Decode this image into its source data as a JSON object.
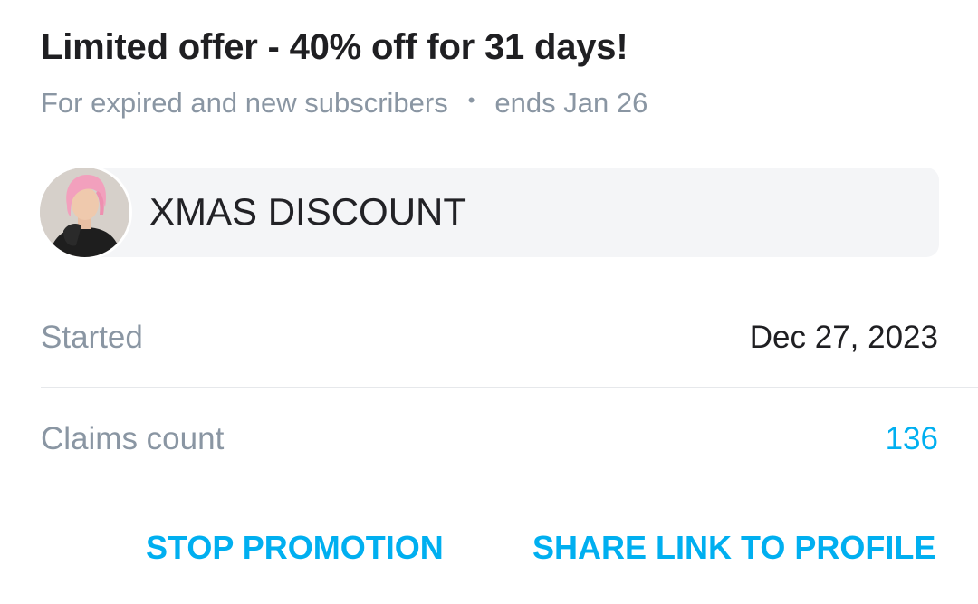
{
  "offer": {
    "title": "Limited offer - 40% off for 31 days!",
    "audience": "For expired and new subscribers",
    "separator": "•",
    "ends": "ends Jan 26"
  },
  "promotion": {
    "name": "XMAS DISCOUNT",
    "avatar_icon": "profile-photo"
  },
  "details": {
    "started_label": "Started",
    "started_value": "Dec 27, 2023",
    "claims_label": "Claims count",
    "claims_value": "136"
  },
  "actions": {
    "stop_label": "STOP PROMOTION",
    "share_label": "SHARE LINK TO PROFILE"
  },
  "colors": {
    "accent": "#00aff0",
    "muted": "#8a96a3",
    "pill_bg": "#f4f5f7"
  }
}
